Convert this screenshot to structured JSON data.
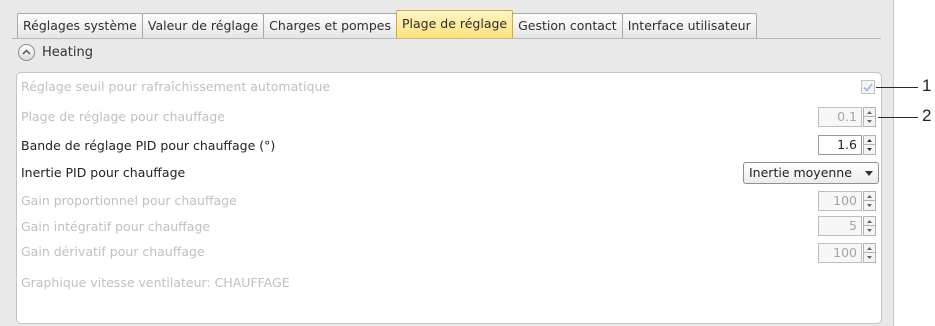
{
  "tabs": [
    {
      "label": "Réglages système"
    },
    {
      "label": "Valeur de réglage"
    },
    {
      "label": "Charges et pompes"
    },
    {
      "label": "Plage de réglage"
    },
    {
      "label": "Gestion contact"
    },
    {
      "label": "Interface utilisateur"
    }
  ],
  "active_tab": "Plage de réglage",
  "section": {
    "title": "Heating",
    "icon": "chevron-up-icon"
  },
  "rows": {
    "auto_cooling": {
      "label": "Réglage seuil pour rafraîchissement automatique",
      "checked": true
    },
    "heating_range": {
      "label": "Plage de réglage pour chauffage",
      "value": "0.1"
    },
    "pid_band": {
      "label": "Bande de réglage PID pour chauffage (°)",
      "value": "1.6"
    },
    "pid_inertia": {
      "label": "Inertie PID pour chauffage",
      "value": "Inertie moyenne"
    },
    "gain_p": {
      "label": "Gain proportionnel pour chauffage",
      "value": "100"
    },
    "gain_i": {
      "label": "Gain intégratif pour chauffage",
      "value": "5"
    },
    "gain_d": {
      "label": "Gain dérivatif pour chauffage",
      "value": "100"
    },
    "fan_graph": {
      "label": "Graphique vitesse ventilateur: CHAUFFAGE"
    }
  },
  "callouts": {
    "one": "1",
    "two": "2"
  },
  "colors": {
    "active_tab": "#ffe27a",
    "active_tab_border": "#d9a93a",
    "disabled_text": "#c0c0c0"
  }
}
